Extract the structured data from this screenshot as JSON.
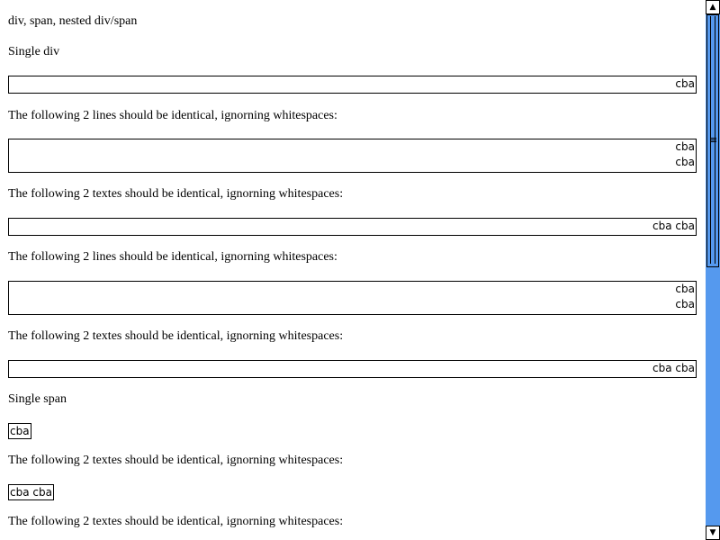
{
  "page": {
    "heading": "div, span, nested div/span",
    "single_div_label": "Single div",
    "single_div_value": "cba",
    "note_lines_1": "The following 2 lines should be identical, ignorning whitespaces:",
    "lines_1": [
      "cba",
      "cba"
    ],
    "note_textes_1": "The following 2 textes should be identical, ignorning whitespaces:",
    "textes_1": "cba cba",
    "note_lines_2": "The following 2 lines should be identical, ignorning whitespaces:",
    "lines_2": [
      "cba",
      "cba"
    ],
    "note_textes_2": "The following 2 textes should be identical, ignorning whitespaces:",
    "textes_2": "cba cba",
    "single_span_label": "Single span",
    "single_span_value": "cba",
    "note_textes_3": "The following 2 textes should be identical, ignorning whitespaces:",
    "textes_3": "cba cba",
    "note_textes_4": "The following 2 textes should be identical, ignorning whitespaces:"
  },
  "scrollbar": {
    "up_icon": "▲",
    "down_icon": "▼",
    "thumb_fraction": 0.49
  },
  "colors": {
    "scrollbar_track": "#5599ee",
    "border": "#000000"
  }
}
